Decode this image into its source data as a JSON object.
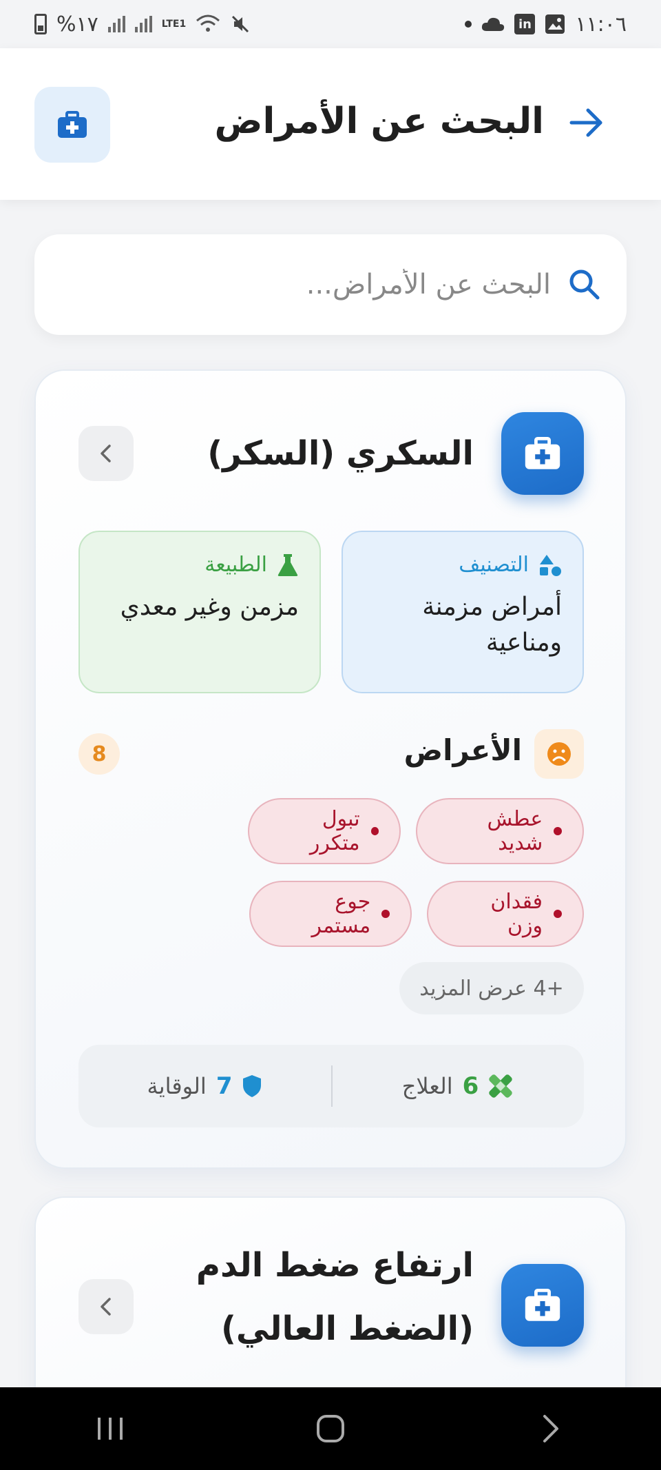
{
  "status_bar": {
    "time": "١١:٠٦",
    "battery_text": "%١٧",
    "network": "LTE1"
  },
  "header": {
    "title": "البحث عن الأمراض"
  },
  "search": {
    "placeholder": "البحث عن الأمراض...",
    "value": ""
  },
  "cards": [
    {
      "title": "السكري (السكر)",
      "classification_label": "التصنيف",
      "classification_value": "أمراض مزمنة ومناعية",
      "nature_label": "الطبيعة",
      "nature_value": "مزمن وغير معدي",
      "symptoms_title": "الأعراض",
      "symptoms_count": "8",
      "symptoms": [
        "عطش شديد",
        "تبول متكرر",
        "فقدان وزن",
        "جوع مستمر"
      ],
      "more_label": "+4 عرض المزيد",
      "treatment_count": "6",
      "treatment_label": "العلاج",
      "prevention_count": "7",
      "prevention_label": "الوقاية"
    },
    {
      "title_line1": "ارتفاع ضغط الدم",
      "title_line2": "(الضغط العالي)"
    }
  ],
  "colors": {
    "primary": "#1d6cc8",
    "symptom_text": "#a8142c",
    "nature_green": "#3aa043",
    "classification_blue": "#1f8fd0",
    "count_orange": "#e58a1f"
  }
}
